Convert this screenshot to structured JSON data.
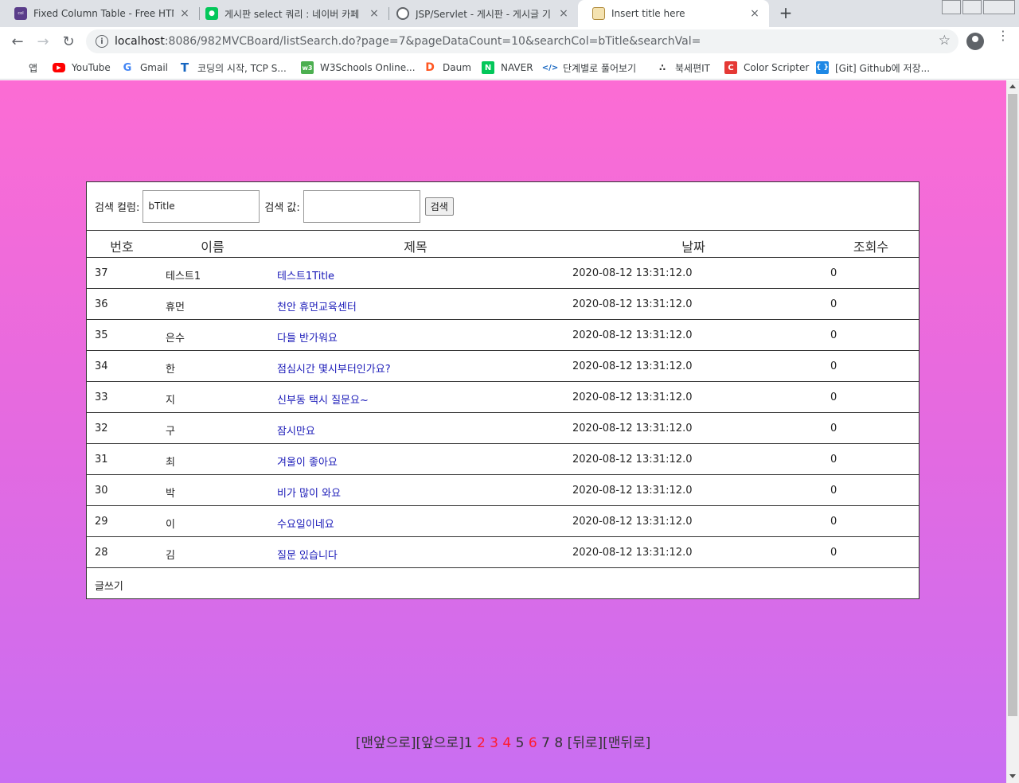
{
  "browser": {
    "tabs": [
      {
        "title": "Fixed Column Table - Free HTML",
        "close": "×",
        "favicon_color": "#5a3d8a",
        "favicon_text": "colorlib"
      },
      {
        "title": "게시판 select 쿼리 : 네이버 카페",
        "close": "×",
        "favicon_color": "#03c75a",
        "favicon_text": ""
      },
      {
        "title": "JSP/Servlet - 게시판 - 게시글 기",
        "close": "×",
        "favicon_color": "#5f6368",
        "favicon_text": ""
      },
      {
        "title": "Insert title here",
        "close": "×",
        "favicon_color": "#d9a441",
        "favicon_text": ""
      }
    ],
    "new_tab": "+",
    "url_host": "localhost",
    "url_rest": ":8086/982MVCBoard/listSearch.do?page=7&pageDataCount=10&searchCol=bTitle&searchVal=",
    "bookmarks": [
      {
        "label": "앱",
        "icon": "apps-icon",
        "color": "#1a73e8"
      },
      {
        "label": "YouTube",
        "icon": "youtube-icon",
        "color": "#ff0000"
      },
      {
        "label": "Gmail",
        "icon": "google-icon",
        "color": "#4285f4"
      },
      {
        "label": "코딩의 시작, TCP S...",
        "icon": "t-icon",
        "color": "#1565c0"
      },
      {
        "label": "W3Schools Online...",
        "icon": "w3-icon",
        "color": "#4caf50"
      },
      {
        "label": "Daum",
        "icon": "daum-icon",
        "color": "#ff5722"
      },
      {
        "label": "NAVER",
        "icon": "naver-icon",
        "color": "#03c75a"
      },
      {
        "label": "단계별로 풀어보기",
        "icon": "code-icon",
        "color": "#1565c0"
      },
      {
        "label": "북세편IT",
        "icon": "dots-icon",
        "color": "#333333"
      },
      {
        "label": "Color Scripter",
        "icon": "c-icon",
        "color": "#e53935"
      },
      {
        "label": "[Git] Github에 저장...",
        "icon": "bracket-icon",
        "color": "#1e88e5"
      }
    ]
  },
  "search": {
    "col_label": "검색 컬럼:",
    "col_value": "bTitle",
    "val_label": "검색 값:",
    "val_value": "",
    "button_label": "검색"
  },
  "table": {
    "headers": [
      "번호",
      "이름",
      "제목",
      "날짜",
      "조회수"
    ],
    "rows": [
      {
        "no": "37",
        "name": "테스트1",
        "title": "테스트1Title",
        "date": "2020-08-12 13:31:12.0",
        "views": "0"
      },
      {
        "no": "36",
        "name": "휴먼",
        "title": "천안 휴먼교육센터",
        "date": "2020-08-12 13:31:12.0",
        "views": "0"
      },
      {
        "no": "35",
        "name": "은수",
        "title": "다들 반가워요",
        "date": "2020-08-12 13:31:12.0",
        "views": "0"
      },
      {
        "no": "34",
        "name": "한",
        "title": "점심시간 몇시부터인가요?",
        "date": "2020-08-12 13:31:12.0",
        "views": "0"
      },
      {
        "no": "33",
        "name": "지",
        "title": "신부동 택시 질문요~",
        "date": "2020-08-12 13:31:12.0",
        "views": "0"
      },
      {
        "no": "32",
        "name": "구",
        "title": "잠시만요",
        "date": "2020-08-12 13:31:12.0",
        "views": "0"
      },
      {
        "no": "31",
        "name": "최",
        "title": "겨울이 좋아요",
        "date": "2020-08-12 13:31:12.0",
        "views": "0"
      },
      {
        "no": "30",
        "name": "박",
        "title": "비가 많이 와요",
        "date": "2020-08-12 13:31:12.0",
        "views": "0"
      },
      {
        "no": "29",
        "name": "이",
        "title": "수요일이네요",
        "date": "2020-08-12 13:31:12.0",
        "views": "0"
      },
      {
        "no": "28",
        "name": "김",
        "title": "질문 있습니다",
        "date": "2020-08-12 13:31:12.0",
        "views": "0"
      }
    ],
    "write_label": "글쓰기"
  },
  "paging": {
    "first": "[맨앞으로]",
    "prev": "[앞으로]",
    "pages": [
      {
        "label": "1",
        "red": false
      },
      {
        "label": "2",
        "red": true
      },
      {
        "label": "3",
        "red": true
      },
      {
        "label": "4",
        "red": true
      },
      {
        "label": "5",
        "red": false
      },
      {
        "label": "6",
        "red": true
      },
      {
        "label": "7",
        "red": false
      },
      {
        "label": "8",
        "red": false
      }
    ],
    "next": "[뒤로]",
    "last": "[맨뒤로]"
  }
}
